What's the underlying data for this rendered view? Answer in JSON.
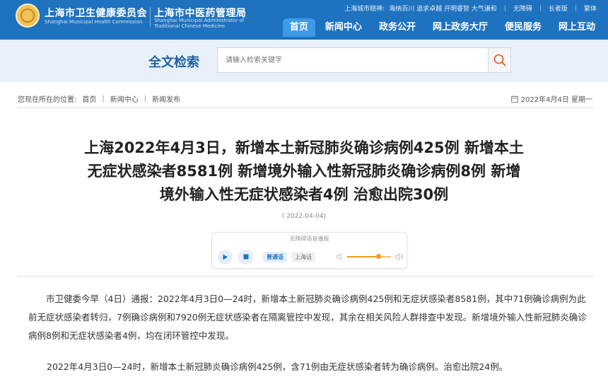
{
  "header": {
    "org1_cn": "上海市卫生健康委员会",
    "org1_en": "Shanghai Municipal Health Commission",
    "org2_cn": "上海市中医药管理局",
    "org2_en": "Shanghai Municipal Administrator of Traditional Chinese Medicine",
    "city_spirit_label": "上海城市精神:",
    "city_spirit": "海纳百川 追求卓越 开明睿智 大气谦和",
    "links": [
      "无障碍",
      "长者版",
      "繁体"
    ],
    "nav": [
      {
        "label": "首页",
        "active": true
      },
      {
        "label": "新闻中心",
        "active": false
      },
      {
        "label": "政务公开",
        "active": false
      },
      {
        "label": "网上政务大厅",
        "active": false
      },
      {
        "label": "便民服务",
        "active": false
      },
      {
        "label": "网上互动",
        "active": false
      }
    ]
  },
  "search": {
    "title": "全文检索",
    "placeholder": "请输入检索关键字"
  },
  "breadcrumb": {
    "prefix": "您现在所在的位置:",
    "items": [
      "首页",
      "新闻中心",
      "新闻发布"
    ],
    "date": "2022年4月4日 星期一"
  },
  "article": {
    "title_lines": [
      "上海2022年4月3日，新增本土新冠肺炎确诊病例425例 新增本土",
      "无症状感染者8581例 新增境外输入性新冠肺炎确诊病例8例 新增",
      "境外输入性无症状感染者4例 治愈出院30例"
    ],
    "pub_date": "( 2022-04-04)",
    "player": {
      "label": "无障碍语音播报",
      "lang_on": "普通话",
      "lang_off": "上海话",
      "volume": 0.72
    },
    "paragraphs": [
      "市卫健委今早（4日）通报：2022年4月3日0—24时，新增本土新冠肺炎确诊病例425例和无症状感染者8581例，其中71例确诊病例为此前无症状感染者转归，7例确诊病例和7920例无症状感染者在隔离管控中发现，其余在相关风险人群排查中发现。新增境外输入性新冠肺炎确诊病例8例和无症状感染者4例，均在闭环管控中发现。",
      "2022年4月3日0—24时，新增本土新冠肺炎确诊病例425例，含71例由无症状感染者转为确诊病例。治愈出院24例。"
    ]
  },
  "colors": {
    "header_bg": "#1f72bf",
    "nav_active": "#3f9ae6",
    "search_band": "#e8f1fa",
    "search_title": "#1f5fa6",
    "accent_orange": "#f39a1f"
  }
}
